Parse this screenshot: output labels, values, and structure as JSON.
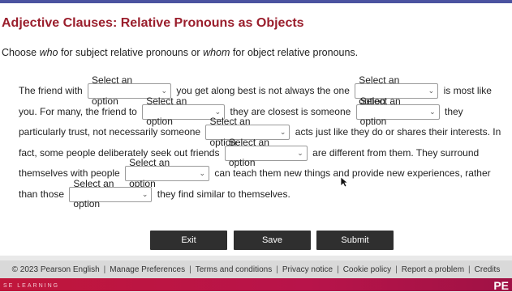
{
  "title": "Adjective Clauses: Relative Pronouns as Objects",
  "instructions": {
    "part1": "Choose ",
    "who": "who",
    "part2": " for subject relative pronouns or ",
    "whom": "whom",
    "part3": " for object relative pronouns."
  },
  "select_placeholder": "Select an option",
  "passage": {
    "t1": "The friend with",
    "t2": "you get along best is not always the one",
    "t3": "is most like you. For many, the friend to",
    "t4": "they are closest is someone",
    "t5": "they particularly trust, not necessarily someone",
    "t6": "acts just like they do or shares their interests. In fact, some people deliberately seek out friends",
    "t7": "are different from them. They surround themselves with people",
    "t8": "can teach them new things and provide new experiences, rather than those",
    "t9": "they find similar to themselves."
  },
  "buttons": {
    "exit": "Exit",
    "save": "Save",
    "submit": "Submit"
  },
  "footer": {
    "copyright": "© 2023 Pearson English",
    "links": [
      "Manage Preferences",
      "Terms and conditions",
      "Privacy notice",
      "Cookie policy",
      "Report a problem",
      "Credits"
    ]
  },
  "bottom": {
    "brand": "SE LEARNING",
    "logo": "PE"
  }
}
